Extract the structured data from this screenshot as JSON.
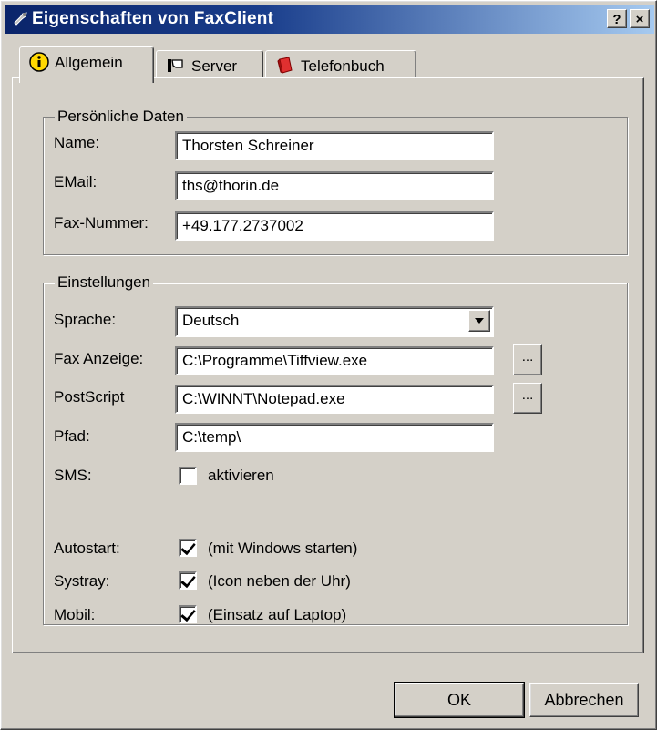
{
  "window": {
    "title": "Eigenschaften von FaxClient",
    "help_label": "?",
    "close_label": "×"
  },
  "tabs": [
    {
      "label": "Allgemein",
      "icon": "info-icon",
      "active": true
    },
    {
      "label": "Server",
      "icon": "server-icon",
      "active": false
    },
    {
      "label": "Telefonbuch",
      "icon": "phonebook-icon",
      "active": false
    }
  ],
  "personal": {
    "group_label": "Persönliche Daten",
    "name_label": "Name:",
    "name_value": "Thorsten Schreiner",
    "email_label": "EMail:",
    "email_value": "ths@thorin.de",
    "fax_label": "Fax-Nummer:",
    "fax_value": "+49.177.2737002"
  },
  "settings": {
    "group_label": "Einstellungen",
    "language_label": "Sprache:",
    "language_value": "Deutsch",
    "faxview_label": "Fax Anzeige:",
    "faxview_value": "C:\\Programme\\Tiffview.exe",
    "postscript_label": "PostScript",
    "postscript_value": "C:\\WINNT\\Notepad.exe",
    "path_label": "Pfad:",
    "path_value": "C:\\temp\\",
    "browse_label": "...",
    "sms_label": "SMS:",
    "sms_checkbox_label": "aktivieren",
    "sms_checked": false,
    "autostart_label": "Autostart:",
    "autostart_checkbox_label": "(mit Windows starten)",
    "autostart_checked": true,
    "systray_label": "Systray:",
    "systray_checkbox_label": "(Icon neben der Uhr)",
    "systray_checked": true,
    "mobil_label": "Mobil:",
    "mobil_checkbox_label": "(Einsatz auf Laptop)",
    "mobil_checked": true
  },
  "buttons": {
    "ok": "OK",
    "cancel": "Abbrechen"
  },
  "colors": {
    "face": "#d4d0c8",
    "titlebar_start": "#0a246a",
    "titlebar_end": "#a6caf0"
  }
}
